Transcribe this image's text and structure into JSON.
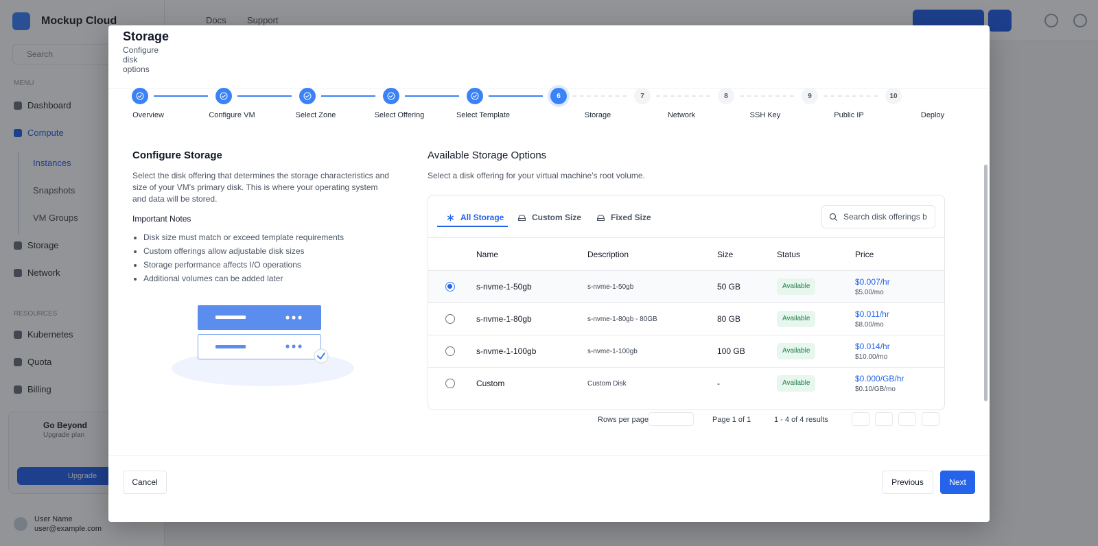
{
  "background": {
    "brand": "Mockup Cloud",
    "search_placeholder": "Search",
    "topnav": [
      "Docs",
      "Support"
    ],
    "sidebar_items": [
      "Dashboard",
      "Compute",
      "Storage",
      "Network"
    ],
    "sidebar_sub_items": [
      "Instances",
      "Snapshots",
      "VM Groups"
    ],
    "section_labels": [
      "Menu",
      "Resources"
    ],
    "resource_items": [
      "Kubernetes",
      "Quota",
      "Billing"
    ],
    "promo_title": "Go Beyond",
    "promo_sub": "Upgrade plan",
    "promo_button": "Upgrade",
    "user_name": "User Name",
    "user_email": "user@example.com"
  },
  "modal": {
    "title": "Storage",
    "subtitle": "Configure disk options",
    "close_label": "Close"
  },
  "stepper": {
    "steps": [
      {
        "num": "1",
        "label": "Overview",
        "state": "done"
      },
      {
        "num": "2",
        "label": "Configure VM",
        "state": "done"
      },
      {
        "num": "3",
        "label": "Select Zone",
        "state": "done"
      },
      {
        "num": "4",
        "label": "Select Offering",
        "state": "done"
      },
      {
        "num": "5",
        "label": "Select Template",
        "state": "done"
      },
      {
        "num": "6",
        "label": "Storage",
        "state": "current"
      },
      {
        "num": "7",
        "label": "Network",
        "state": "todo"
      },
      {
        "num": "8",
        "label": "SSH Key",
        "state": "todo"
      },
      {
        "num": "9",
        "label": "Public IP",
        "state": "todo"
      },
      {
        "num": "10",
        "label": "Deploy",
        "state": "todo"
      }
    ]
  },
  "left": {
    "title": "Configure Storage",
    "description": "Select the disk offering that determines the storage characteristics and size of your VM's primary disk. This is where your operating system and data will be stored.",
    "notes_title": "Important Notes",
    "notes": [
      "Disk size must match or exceed template requirements",
      "Custom offerings allow adjustable disk sizes",
      "Storage performance affects I/O operations",
      "Additional volumes can be added later"
    ]
  },
  "right": {
    "title": "Available Storage Options",
    "subtitle": "Select a disk offering for your virtual machine's root volume.",
    "tabs": [
      {
        "label": "All Storage",
        "active": true,
        "icon": "asterisk-icon"
      },
      {
        "label": "Custom Size",
        "active": false,
        "icon": "hard-drive-icon"
      },
      {
        "label": "Fixed Size",
        "active": false,
        "icon": "hard-drive-icon"
      }
    ],
    "search_placeholder": "Search disk offerings by name",
    "columns": [
      "Name",
      "Description",
      "Size",
      "Status",
      "Price"
    ],
    "rows": [
      {
        "name": "s-nvme-1-50gb",
        "description": "s-nvme-1-50gb",
        "size": "50 GB",
        "status": "Available",
        "price_hr": "$0.007/hr",
        "price_mo": "$5.00/mo",
        "selected": true
      },
      {
        "name": "s-nvme-1-80gb",
        "description": "s-nvme-1-80gb - 80GB",
        "size": "80 GB",
        "status": "Available",
        "price_hr": "$0.011/hr",
        "price_mo": "$8.00/mo",
        "selected": false
      },
      {
        "name": "s-nvme-1-100gb",
        "description": "s-nvme-1-100gb",
        "size": "100 GB",
        "status": "Available",
        "price_hr": "$0.014/hr",
        "price_mo": "$10.00/mo",
        "selected": false
      },
      {
        "name": "Custom",
        "description": "Custom Disk",
        "size": "-",
        "status": "Available",
        "price_hr": "$0.000/GB/hr",
        "price_mo": "$0.10/GB/mo",
        "selected": false
      }
    ],
    "pager": {
      "rows_label": "Rows per page",
      "page_label": "Page 1 of 1",
      "count_label": "1 - 4 of 4 results"
    }
  },
  "footer": {
    "cancel": "Cancel",
    "previous": "Previous",
    "next": "Next"
  },
  "colors": {
    "accent": "#2563eb",
    "badge_bg": "#e7f7ee",
    "badge_text": "#1f7a47"
  }
}
